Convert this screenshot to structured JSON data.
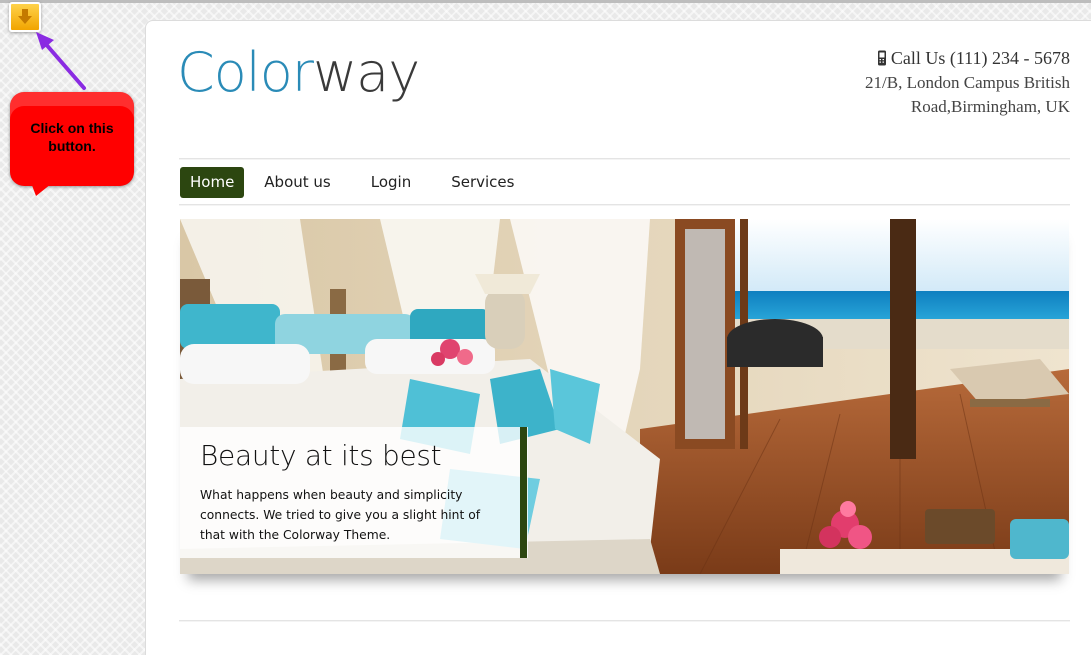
{
  "download_button": {
    "icon": "arrow-down-icon",
    "color": "#f1a400"
  },
  "annotation": {
    "callout_text": "Click on this button.",
    "color": "#ff0000",
    "arrow_color": "#8a2be2"
  },
  "header": {
    "logo_part1": "Color",
    "logo_part2": "way",
    "logo_colors": {
      "part1": "#2a8bb7",
      "part2": "#3a3a3a"
    },
    "phone_icon": "mobile-phone-icon",
    "phone": "Call Us (111) 234 - 5678",
    "address_line1": "21/B, London Campus British",
    "address_line2": "Road,Birmingham, UK"
  },
  "nav": {
    "items": [
      {
        "label": "Home",
        "active": true
      },
      {
        "label": "About us",
        "active": false
      },
      {
        "label": "Login",
        "active": false
      },
      {
        "label": "Services",
        "active": false
      }
    ],
    "active_color": "#2c4610"
  },
  "hero": {
    "image": "resort-bedroom-ocean-view",
    "caption_title": "Beauty at its best",
    "caption_text": "What happens when beauty and simplicity connects. We tried to give you a slight hint of that with the Colorway Theme."
  }
}
